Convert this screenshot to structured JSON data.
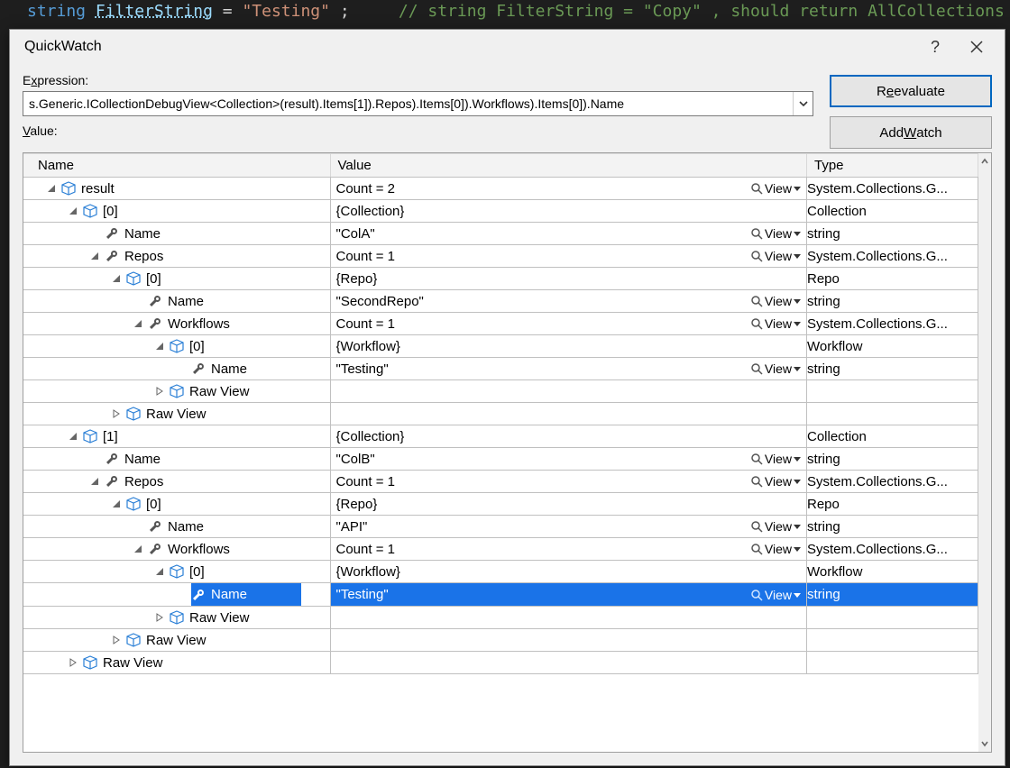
{
  "code_bg": {
    "kw": "string",
    "ident": "FilterString",
    "op": " = ",
    "str": "\"Testing\"",
    "semi": ";",
    "comment": "// string FilterString = \"Copy\" , should return  AllCollections"
  },
  "dialog": {
    "title": "QuickWatch",
    "help_label": "?",
    "expression_label_pre": "E",
    "expression_label_mid": "x",
    "expression_label_post": "pression:",
    "expression_value": "s.Generic.ICollectionDebugView<Collection>(result).Items[1]).Repos).Items[0]).Workflows).Items[0]).Name",
    "value_label_pre": "V",
    "value_label_mid": "a",
    "value_label_post": "lue:",
    "reevaluate_pre": "R",
    "reevaluate_mid": "e",
    "reevaluate_post": "evaluate",
    "addwatch_pre": "Add ",
    "addwatch_mid": "W",
    "addwatch_post": "atch"
  },
  "columns": {
    "name": "Name",
    "value": "Value",
    "type": "Type"
  },
  "view_label": "View",
  "rows": [
    {
      "depth": 0,
      "exp": "open",
      "icon": "box",
      "name": "result",
      "value": "Count = 2",
      "view": true,
      "type": "System.Collections.G..."
    },
    {
      "depth": 1,
      "exp": "open",
      "icon": "box",
      "name": "[0]",
      "value": "{Collection}",
      "view": false,
      "type": "Collection"
    },
    {
      "depth": 2,
      "exp": "none",
      "icon": "wrench",
      "name": "Name",
      "value": "\"ColA\"",
      "view": true,
      "type": "string"
    },
    {
      "depth": 2,
      "exp": "open",
      "icon": "wrench",
      "name": "Repos",
      "value": "Count = 1",
      "view": true,
      "type": "System.Collections.G..."
    },
    {
      "depth": 3,
      "exp": "open",
      "icon": "box",
      "name": "[0]",
      "value": "{Repo}",
      "view": false,
      "type": "Repo"
    },
    {
      "depth": 4,
      "exp": "none",
      "icon": "wrench",
      "name": "Name",
      "value": "\"SecondRepo\"",
      "view": true,
      "type": "string"
    },
    {
      "depth": 4,
      "exp": "open",
      "icon": "wrench",
      "name": "Workflows",
      "value": "Count = 1",
      "view": true,
      "type": "System.Collections.G..."
    },
    {
      "depth": 5,
      "exp": "open",
      "icon": "box",
      "name": "[0]",
      "value": "{Workflow}",
      "view": false,
      "type": "Workflow"
    },
    {
      "depth": 6,
      "exp": "none",
      "icon": "wrench",
      "name": "Name",
      "value": "\"Testing\"",
      "view": true,
      "type": "string"
    },
    {
      "depth": 5,
      "exp": "closed",
      "icon": "box",
      "name": "Raw View",
      "value": "",
      "view": false,
      "type": ""
    },
    {
      "depth": 3,
      "exp": "closed",
      "icon": "box",
      "name": "Raw View",
      "value": "",
      "view": false,
      "type": ""
    },
    {
      "depth": 1,
      "exp": "open",
      "icon": "box",
      "name": "[1]",
      "value": "{Collection}",
      "view": false,
      "type": "Collection"
    },
    {
      "depth": 2,
      "exp": "none",
      "icon": "wrench",
      "name": "Name",
      "value": "\"ColB\"",
      "view": true,
      "type": "string"
    },
    {
      "depth": 2,
      "exp": "open",
      "icon": "wrench",
      "name": "Repos",
      "value": "Count = 1",
      "view": true,
      "type": "System.Collections.G..."
    },
    {
      "depth": 3,
      "exp": "open",
      "icon": "box",
      "name": "[0]",
      "value": "{Repo}",
      "view": false,
      "type": "Repo"
    },
    {
      "depth": 4,
      "exp": "none",
      "icon": "wrench",
      "name": "Name",
      "value": "\"API\"",
      "view": true,
      "type": "string"
    },
    {
      "depth": 4,
      "exp": "open",
      "icon": "wrench",
      "name": "Workflows",
      "value": "Count = 1",
      "view": true,
      "type": "System.Collections.G..."
    },
    {
      "depth": 5,
      "exp": "open",
      "icon": "box",
      "name": "[0]",
      "value": "{Workflow}",
      "view": false,
      "type": "Workflow"
    },
    {
      "depth": 6,
      "exp": "none",
      "icon": "wrench",
      "name": "Name",
      "value": "\"Testing\"",
      "view": true,
      "type": "string",
      "selected": true
    },
    {
      "depth": 5,
      "exp": "closed",
      "icon": "box",
      "name": "Raw View",
      "value": "",
      "view": false,
      "type": ""
    },
    {
      "depth": 3,
      "exp": "closed",
      "icon": "box",
      "name": "Raw View",
      "value": "",
      "view": false,
      "type": ""
    },
    {
      "depth": 1,
      "exp": "closed",
      "icon": "box",
      "name": "Raw View",
      "value": "",
      "view": false,
      "type": ""
    }
  ]
}
